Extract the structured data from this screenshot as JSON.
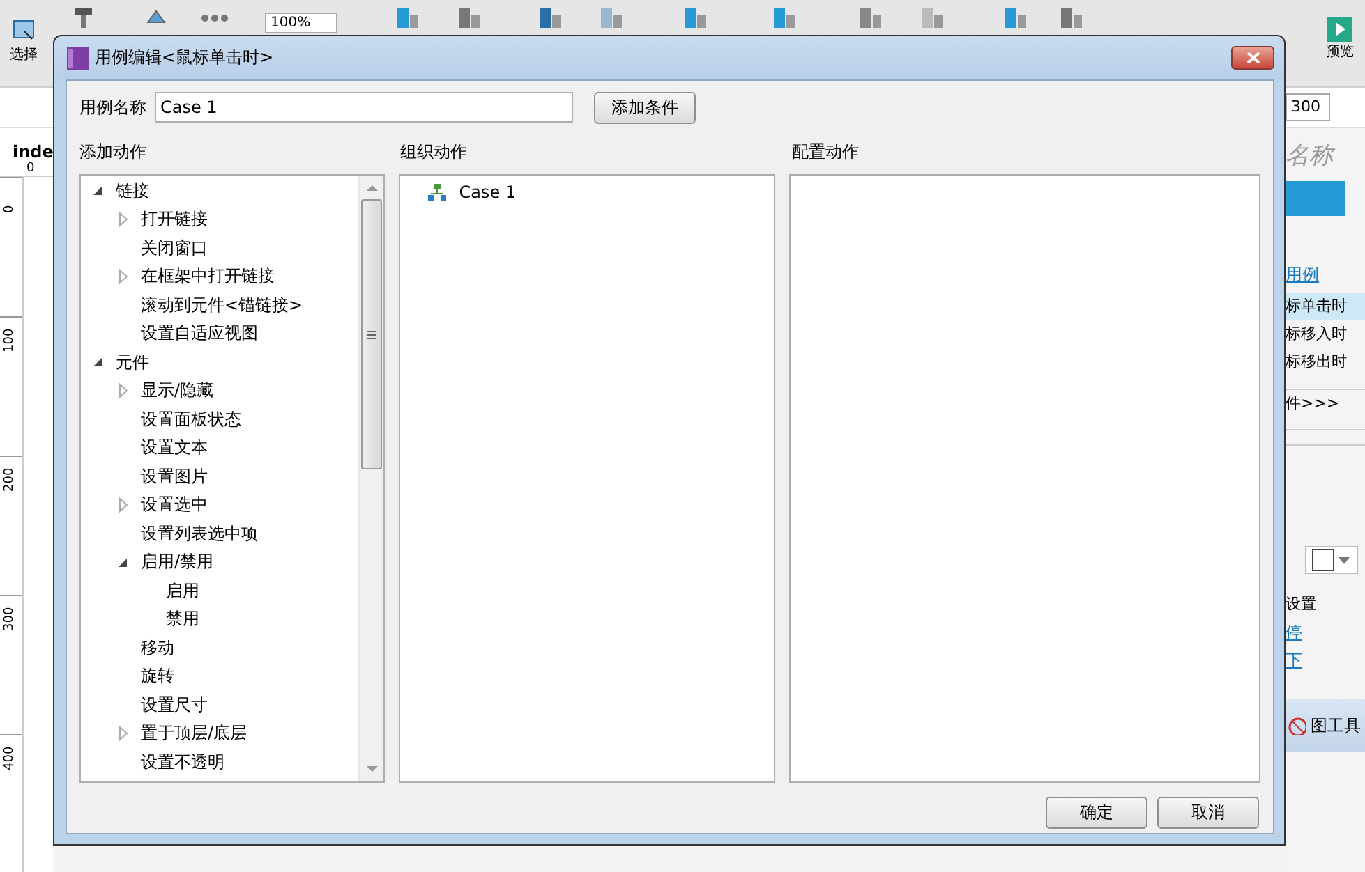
{
  "app": {
    "toolbar": {
      "select_label": "选择",
      "zoom": "100%",
      "preview_label": "预览"
    },
    "width_field": "300",
    "page_tab": "inde",
    "ruler": {
      "x_labels": [
        "0"
      ],
      "y_labels": [
        "0",
        "100",
        "200",
        "300",
        "400"
      ]
    },
    "inspector": {
      "title": "名称",
      "cases_link": "用例",
      "events": [
        {
          "label": "标单击时",
          "selected": true
        },
        {
          "label": "标移入时",
          "selected": false
        },
        {
          "label": "标移出时",
          "selected": false
        }
      ],
      "more": "件>>>",
      "settings_label": "设置",
      "links": [
        "停",
        "下"
      ],
      "tool_tab": "图工具"
    }
  },
  "dialog": {
    "title": "用例编辑<鼠标单击时>",
    "case_name_label": "用例名称",
    "case_name": "Case 1",
    "add_condition": "添加条件",
    "columns": [
      "添加动作",
      "组织动作",
      "配置动作"
    ],
    "actions": [
      {
        "label": "链接",
        "expanded": true,
        "children": [
          {
            "label": "打开链接",
            "expanded": false
          },
          {
            "label": "关闭窗口"
          },
          {
            "label": "在框架中打开链接",
            "expanded": false
          },
          {
            "label": "滚动到元件<锚链接>"
          },
          {
            "label": "设置自适应视图"
          }
        ]
      },
      {
        "label": "元件",
        "expanded": true,
        "children": [
          {
            "label": "显示/隐藏",
            "expanded": false
          },
          {
            "label": "设置面板状态"
          },
          {
            "label": "设置文本"
          },
          {
            "label": "设置图片"
          },
          {
            "label": "设置选中",
            "expanded": false
          },
          {
            "label": "设置列表选中项"
          },
          {
            "label": "启用/禁用",
            "expanded": true,
            "children": [
              {
                "label": "启用"
              },
              {
                "label": "禁用"
              }
            ]
          },
          {
            "label": "移动"
          },
          {
            "label": "旋转"
          },
          {
            "label": "设置尺寸"
          },
          {
            "label": "置于顶层/底层",
            "expanded": false
          },
          {
            "label": "设置不透明"
          }
        ]
      }
    ],
    "organized": [
      {
        "label": "Case 1"
      }
    ],
    "buttons": [
      "确定",
      "取消"
    ]
  }
}
